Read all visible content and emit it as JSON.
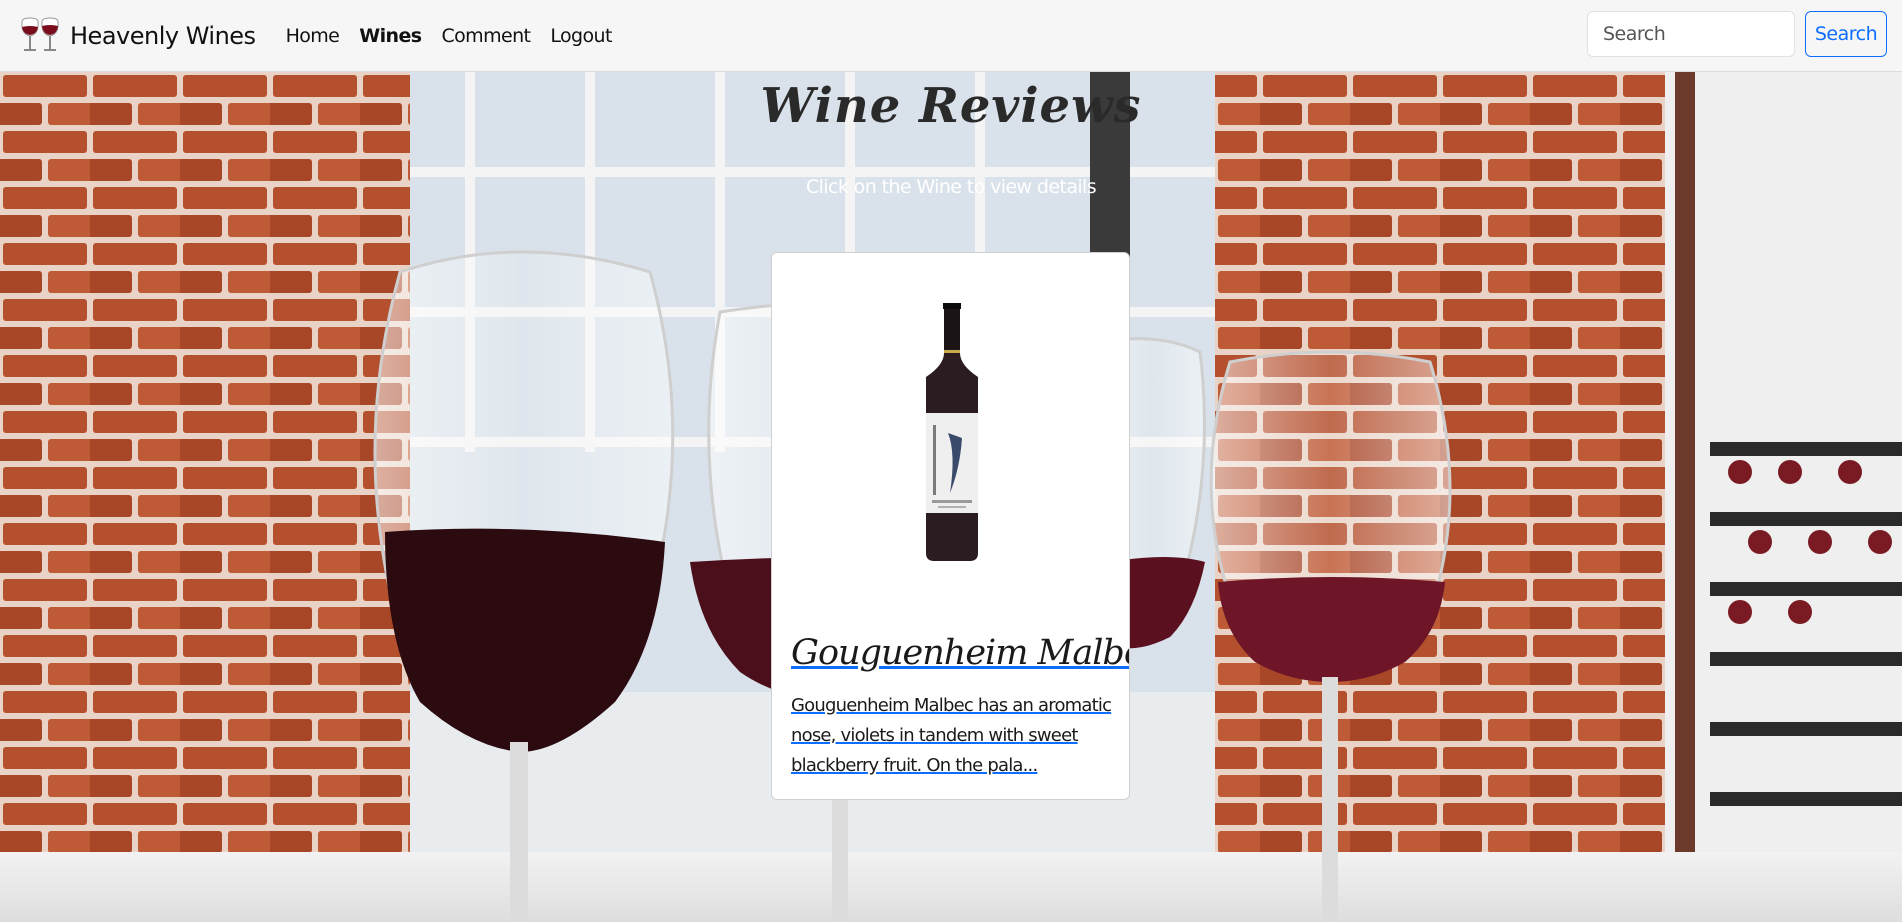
{
  "navbar": {
    "brand_name": "Heavenly Wines",
    "logo_icon": "wine-glasses-icon",
    "links": [
      {
        "label": "Home",
        "active": false
      },
      {
        "label": "Wines",
        "active": true
      },
      {
        "label": "Comment",
        "active": false
      },
      {
        "label": "Logout",
        "active": false
      }
    ],
    "search": {
      "placeholder": "Search",
      "button_label": "Search"
    }
  },
  "main": {
    "heading": "Wine Reviews",
    "subtitle": "Click on the Wine to view details",
    "cards": [
      {
        "title": "Gouguenheim Malbec",
        "description": "Gouguenheim Malbec has an aromatic nose, violets in tandem with sweet blackberry fruit. On the pala...",
        "image_icon": "wine-bottle-image"
      }
    ]
  },
  "colors": {
    "accent": "#0d6efd",
    "navbar_bg": "#f6f6f6",
    "brick": "#b5512f",
    "wine": "#5a0f1c"
  }
}
